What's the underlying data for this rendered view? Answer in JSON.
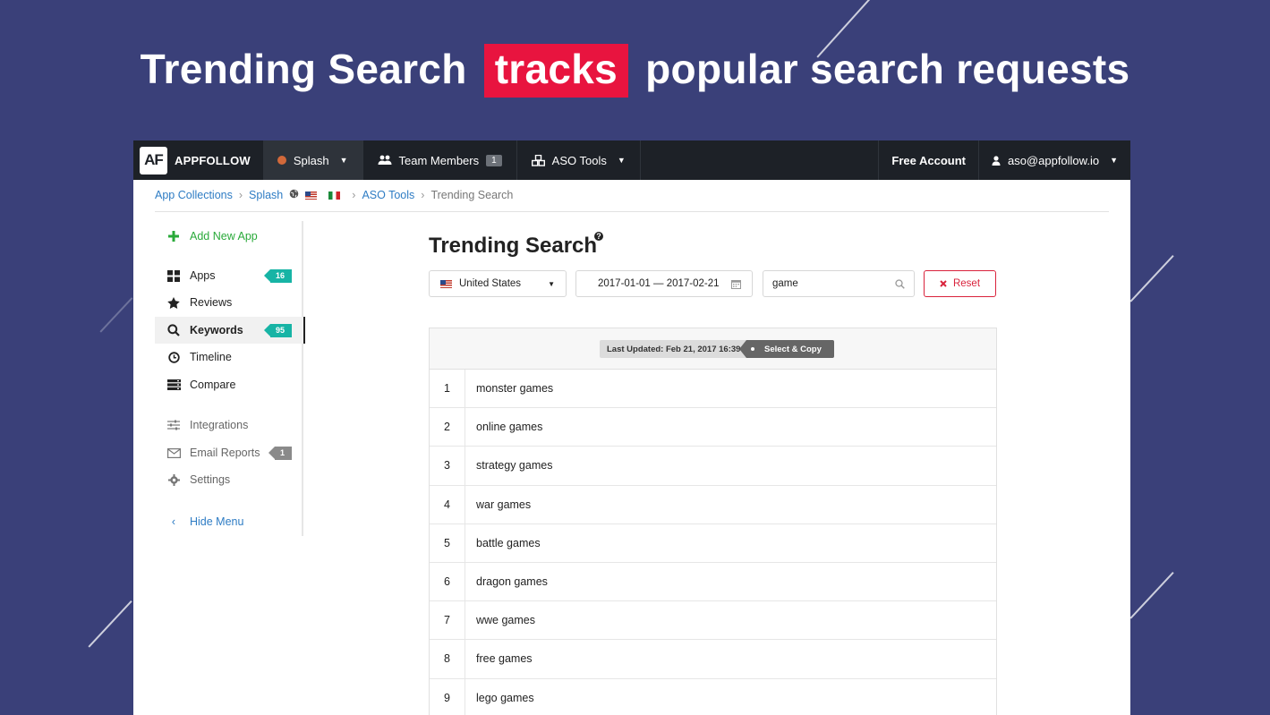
{
  "headline": {
    "before": "Trending Search",
    "highlight": "tracks",
    "after": "popular search requests",
    "highlight_color": "#e8143f"
  },
  "topbar": {
    "brand_logo": "AF",
    "brand_name": "APPFOLLOW",
    "app_menu_label": "Splash",
    "team_members_label": "Team Members",
    "team_members_count": "1",
    "aso_tools_label": "ASO Tools",
    "account_label": "Free Account",
    "user_email": "aso@appfollow.io"
  },
  "breadcrumb": {
    "collections": "App Collections",
    "app": "Splash",
    "aso_tools": "ASO Tools",
    "current": "Trending Search"
  },
  "sidebar": {
    "add_new_app": "Add New App",
    "apps": "Apps",
    "apps_count": "16",
    "reviews": "Reviews",
    "keywords": "Keywords",
    "keywords_count": "95",
    "timeline": "Timeline",
    "compare": "Compare",
    "integrations": "Integrations",
    "email_reports": "Email Reports",
    "email_reports_count": "1",
    "settings": "Settings",
    "hide_menu": "Hide Menu"
  },
  "main": {
    "title": "Trending Search",
    "help_icon": "question-icon",
    "country": "United States",
    "date_range": "2017-01-01 — 2017-02-21",
    "search_value": "game",
    "reset_label": "Reset",
    "last_updated": "Last Updated: Feb 21, 2017 16:39",
    "select_copy": "Select & Copy",
    "rows": [
      {
        "num": "1",
        "keyword": "monster games"
      },
      {
        "num": "2",
        "keyword": "online games"
      },
      {
        "num": "3",
        "keyword": "strategy games"
      },
      {
        "num": "4",
        "keyword": "war games"
      },
      {
        "num": "5",
        "keyword": "battle games"
      },
      {
        "num": "6",
        "keyword": "dragon games"
      },
      {
        "num": "7",
        "keyword": "wwe games"
      },
      {
        "num": "8",
        "keyword": "free games"
      },
      {
        "num": "9",
        "keyword": "lego games"
      }
    ]
  },
  "colors": {
    "background": "#3a4079",
    "topbar": "#1d2127",
    "link": "#2e7cc4",
    "accent_green": "#2aaa3a",
    "badge_teal": "#17b4a5",
    "reset_red": "#d9233c"
  }
}
